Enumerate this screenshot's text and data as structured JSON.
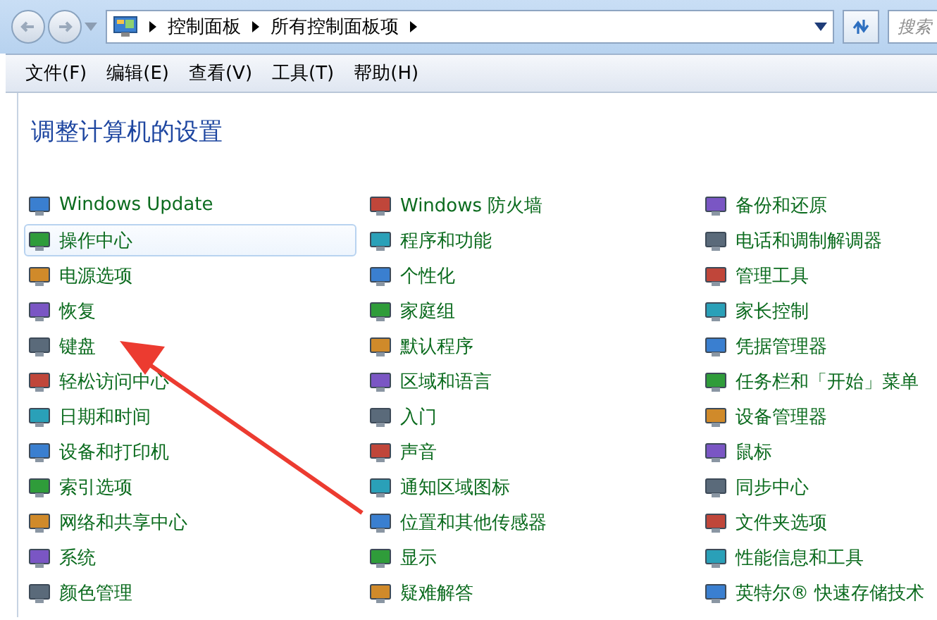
{
  "navigation": {
    "breadcrumbs": [
      "控制面板",
      "所有控制面板项"
    ]
  },
  "search": {
    "placeholder": "搜索"
  },
  "menu": [
    "文件(F)",
    "编辑(E)",
    "查看(V)",
    "工具(T)",
    "帮助(H)"
  ],
  "heading": "调整计算机的设置",
  "columns": [
    [
      {
        "label": "Windows Update",
        "selected": false
      },
      {
        "label": "操作中心",
        "selected": true
      },
      {
        "label": "电源选项",
        "selected": false
      },
      {
        "label": "恢复",
        "selected": false
      },
      {
        "label": "键盘",
        "selected": false
      },
      {
        "label": "轻松访问中心",
        "selected": false
      },
      {
        "label": "日期和时间",
        "selected": false
      },
      {
        "label": "设备和打印机",
        "selected": false
      },
      {
        "label": "索引选项",
        "selected": false
      },
      {
        "label": "网络和共享中心",
        "selected": false
      },
      {
        "label": "系统",
        "selected": false
      },
      {
        "label": "颜色管理",
        "selected": false
      }
    ],
    [
      {
        "label": "Windows 防火墙",
        "selected": false
      },
      {
        "label": "程序和功能",
        "selected": false
      },
      {
        "label": "个性化",
        "selected": false
      },
      {
        "label": "家庭组",
        "selected": false
      },
      {
        "label": "默认程序",
        "selected": false
      },
      {
        "label": "区域和语言",
        "selected": false
      },
      {
        "label": "入门",
        "selected": false
      },
      {
        "label": "声音",
        "selected": false
      },
      {
        "label": "通知区域图标",
        "selected": false
      },
      {
        "label": "位置和其他传感器",
        "selected": false
      },
      {
        "label": "显示",
        "selected": false
      },
      {
        "label": "疑难解答",
        "selected": false
      }
    ],
    [
      {
        "label": "备份和还原",
        "selected": false
      },
      {
        "label": "电话和调制解调器",
        "selected": false
      },
      {
        "label": "管理工具",
        "selected": false
      },
      {
        "label": "家长控制",
        "selected": false
      },
      {
        "label": "凭据管理器",
        "selected": false
      },
      {
        "label": "任务栏和「开始」菜单",
        "selected": false
      },
      {
        "label": "设备管理器",
        "selected": false
      },
      {
        "label": "鼠标",
        "selected": false
      },
      {
        "label": "同步中心",
        "selected": false
      },
      {
        "label": "文件夹选项",
        "selected": false
      },
      {
        "label": "性能信息和工具",
        "selected": false
      },
      {
        "label": "英特尔® 快速存储技术",
        "selected": false
      }
    ]
  ]
}
